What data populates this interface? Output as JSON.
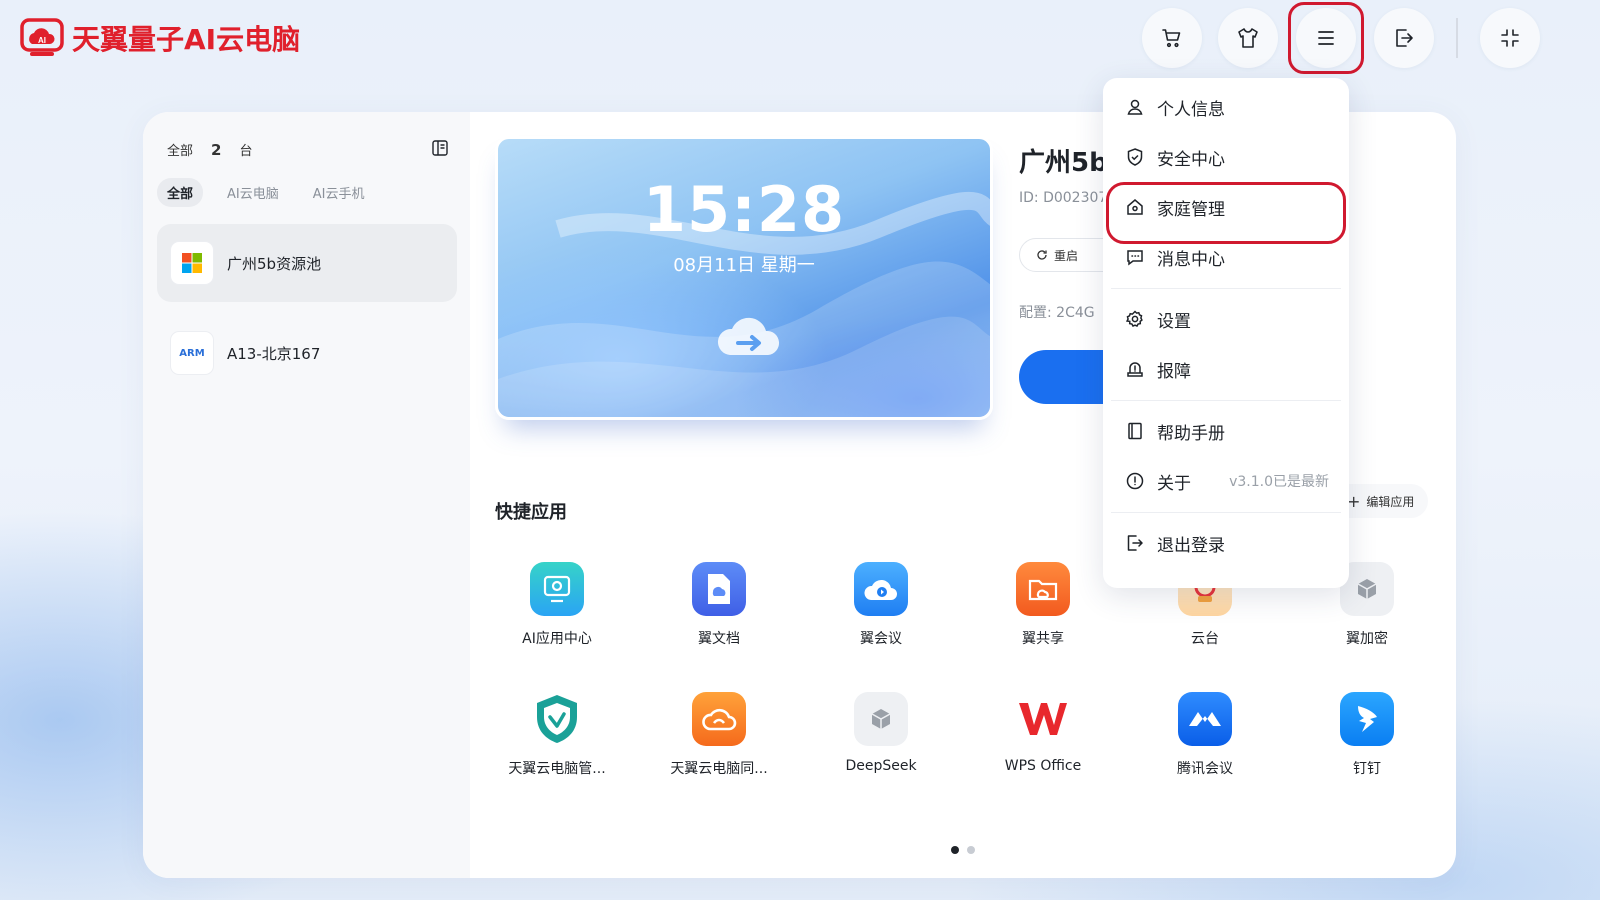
{
  "app": {
    "title": "天翼量子AI云电脑",
    "brand_color": "#e0202c"
  },
  "header": {
    "buttons": [
      {
        "name": "cart",
        "icon": "cart-icon"
      },
      {
        "name": "skin",
        "icon": "shirt-icon"
      },
      {
        "name": "menu",
        "icon": "menu-icon"
      },
      {
        "name": "exit",
        "icon": "exit-icon"
      },
      {
        "name": "collapse",
        "icon": "shrink-icon"
      }
    ]
  },
  "sidebar": {
    "all_label": "全部",
    "count": "2",
    "unit": "台",
    "filters": [
      "全部",
      "AI云电脑",
      "AI云手机"
    ],
    "devices": [
      {
        "name": "广州5b资源池",
        "icon": "windows-icon"
      },
      {
        "name": "A13-北京167",
        "badge": "ARM"
      }
    ]
  },
  "preview": {
    "time": "15:28",
    "date": "08月11日  星期一"
  },
  "device_info": {
    "title": "广州5b",
    "id": "ID: D002307",
    "restart_label": "重启",
    "spec": "配置:  2C4G"
  },
  "quick_apps": {
    "title": "快捷应用",
    "edit_label": "编辑应用",
    "apps": [
      {
        "label": "AI应用中心"
      },
      {
        "label": "翼文档"
      },
      {
        "label": "翼会议"
      },
      {
        "label": "翼共享"
      },
      {
        "label": "云台"
      },
      {
        "label": "翼加密"
      },
      {
        "label": "天翼云电脑管..."
      },
      {
        "label": "天翼云电脑同..."
      },
      {
        "label": "DeepSeek"
      },
      {
        "label": "WPS Office"
      },
      {
        "label": "腾讯会议"
      },
      {
        "label": "钉钉"
      }
    ],
    "page_count": 2,
    "current_page": 1
  },
  "menu": {
    "items": [
      {
        "label": "个人信息",
        "icon": "user-icon"
      },
      {
        "label": "安全中心",
        "icon": "shield-icon"
      },
      {
        "label": "家庭管理",
        "icon": "home-icon"
      },
      {
        "label": "消息中心",
        "icon": "message-icon"
      },
      {
        "label": "设置",
        "icon": "gear-icon"
      },
      {
        "label": "报障",
        "icon": "alert-icon"
      },
      {
        "label": "帮助手册",
        "icon": "book-icon"
      },
      {
        "label": "关于",
        "icon": "info-icon",
        "extra": "v3.1.0已是最新"
      },
      {
        "label": "退出登录",
        "icon": "logout-icon"
      }
    ]
  }
}
